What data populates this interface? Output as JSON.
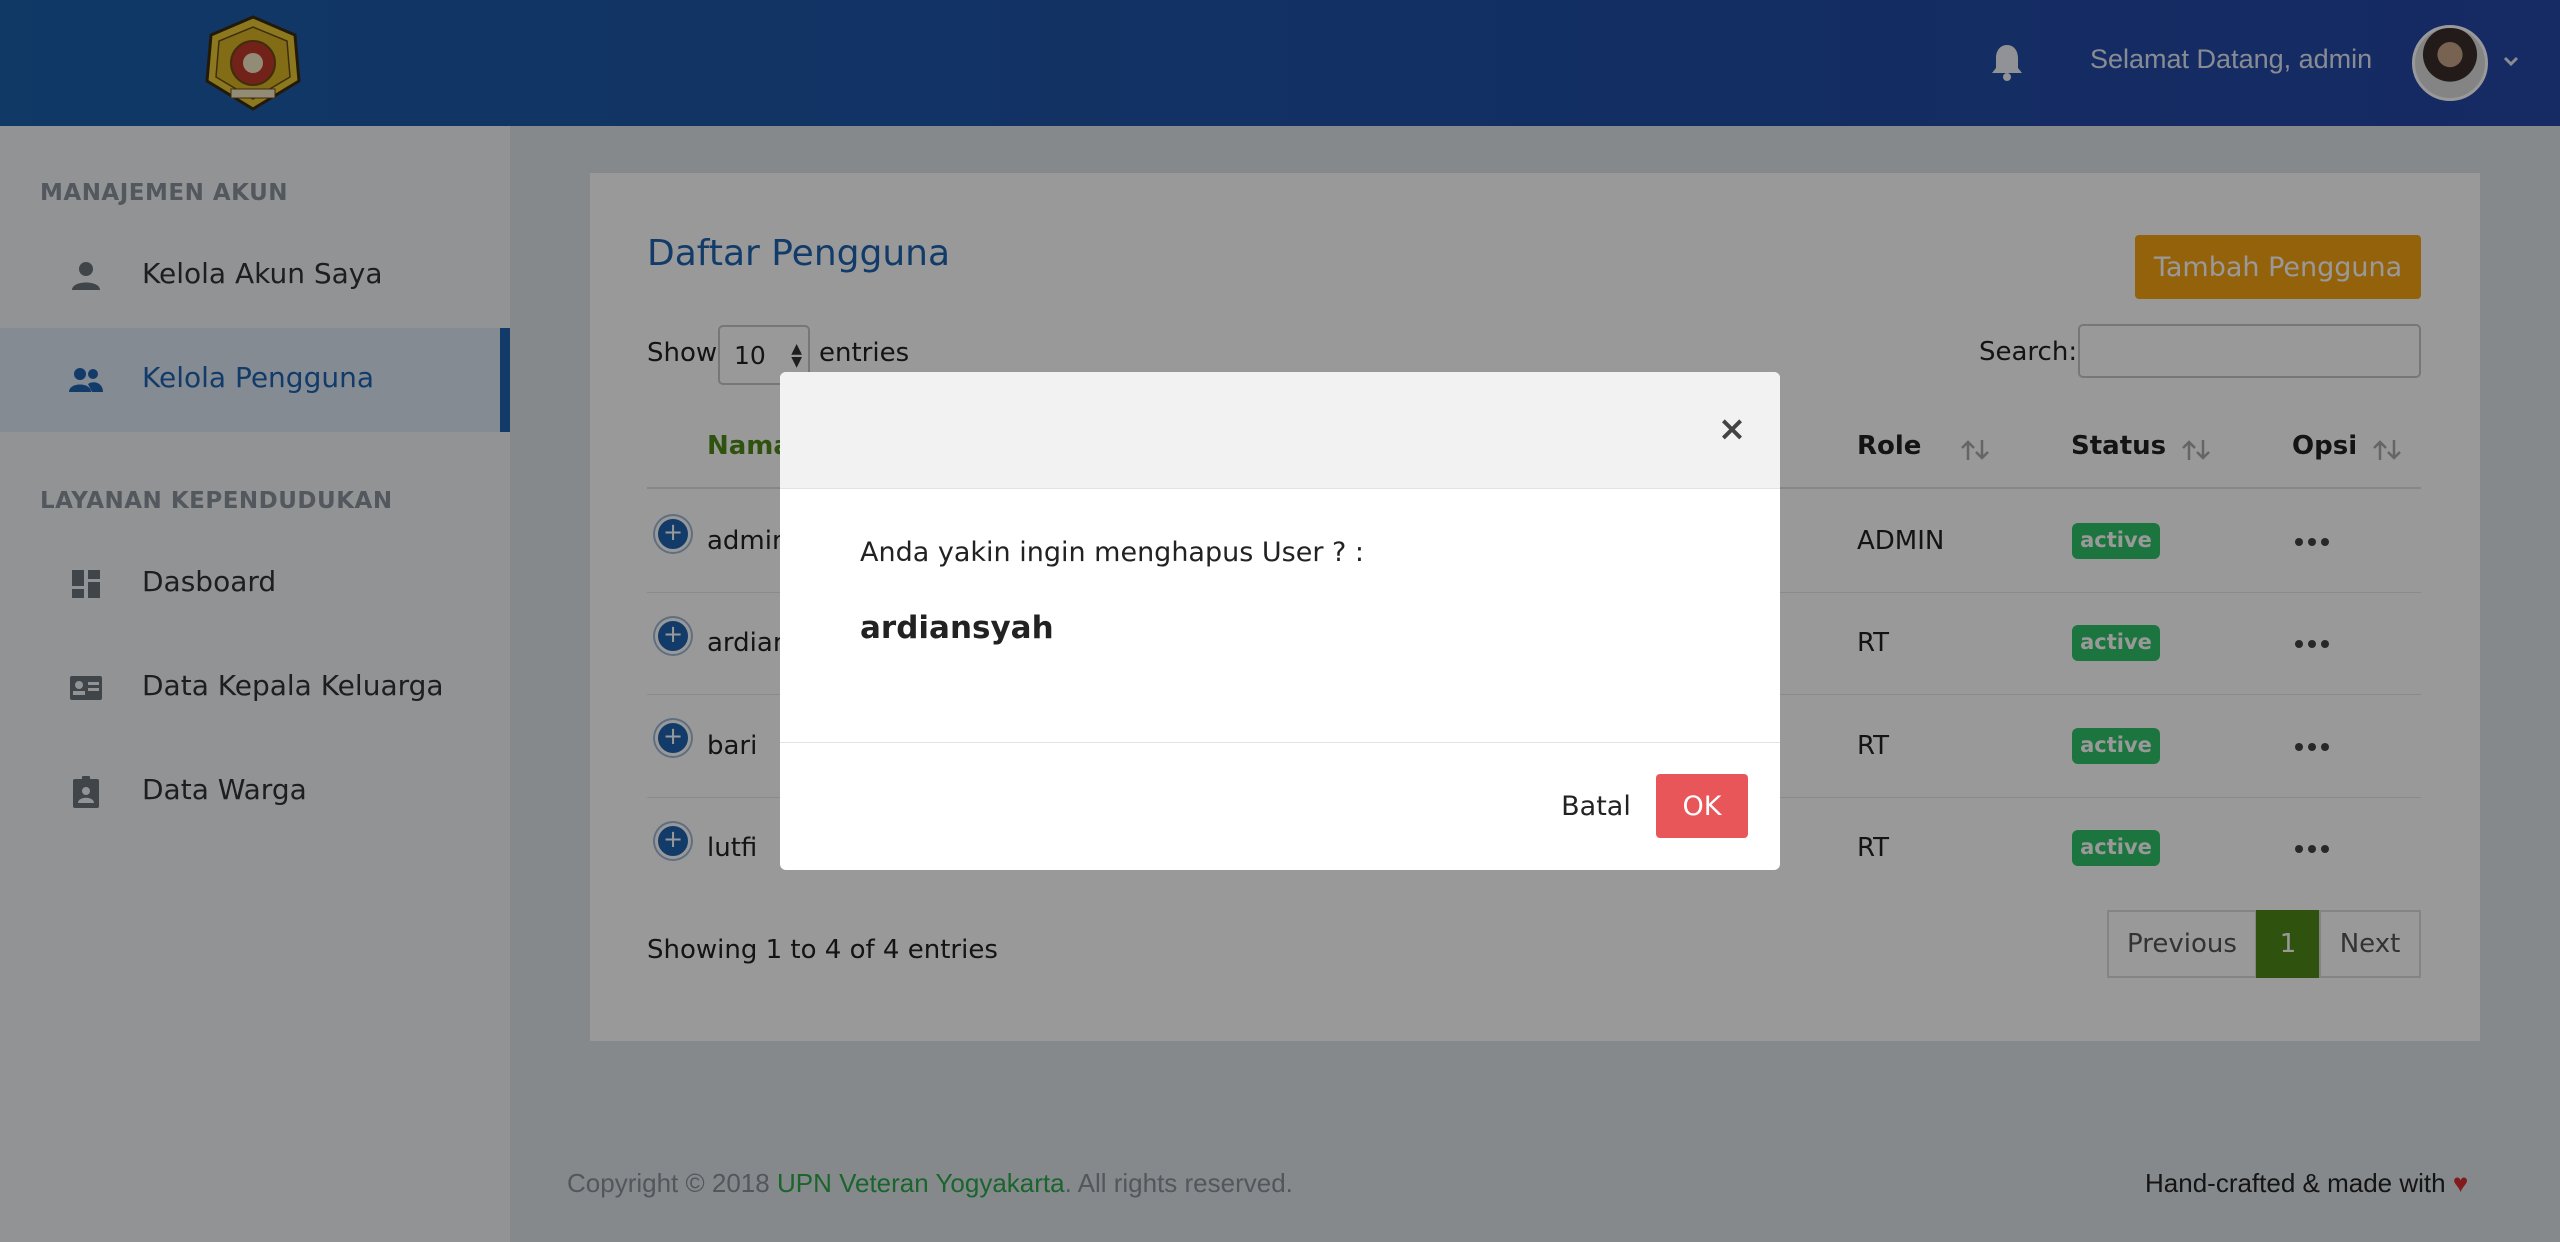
{
  "header": {
    "welcome": "Selamat Datang, admin",
    "icons": {
      "bell": "bell-icon",
      "caret": "chevron-down-icon",
      "logo": "university-seal-logo"
    },
    "colors": {
      "bar_start": "#1c5fab",
      "bar_end": "#2546a6"
    }
  },
  "sidebar": {
    "section_account": "MANAJEMEN AKUN",
    "section_services": "LAYANAN KEPENDUDUKAN",
    "items": [
      {
        "label": "Kelola Akun Saya",
        "icon": "person-icon",
        "active": false
      },
      {
        "label": "Kelola Pengguna",
        "icon": "people-icon",
        "active": true
      },
      {
        "label": "Dasboard",
        "icon": "dashboard-icon",
        "active": false
      },
      {
        "label": "Data Kepala Keluarga",
        "icon": "id-card-icon",
        "active": false
      },
      {
        "label": "Data Warga",
        "icon": "badge-icon",
        "active": false
      }
    ],
    "active_color": "#1e63b0"
  },
  "main": {
    "title": "Daftar Pengguna",
    "add_button": "Tambah Pengguna",
    "show_label": "Show",
    "entries_value": "10",
    "entries_label": "entries",
    "search_label": "Search:",
    "search_value": "",
    "columns": {
      "name": "Nama",
      "role": "Role",
      "status": "Status",
      "options": "Opsi"
    },
    "rows": [
      {
        "name": "admin",
        "role": "ADMIN",
        "status": "active"
      },
      {
        "name": "ardian",
        "role": "RT",
        "status": "active"
      },
      {
        "name": "bari",
        "role": "RT",
        "status": "active"
      },
      {
        "name": "lutfi",
        "role": "RT",
        "status": "active"
      }
    ],
    "info": "Showing 1 to 4 of 4 entries",
    "pagination": {
      "previous": "Previous",
      "current": "1",
      "next": "Next"
    },
    "colors": {
      "add_button": "#f7a313",
      "badge": "#2fc168",
      "page_current": "#4f8a18"
    }
  },
  "footer": {
    "copyright_prefix": "Copyright © 2018 ",
    "brand": "UPN Veteran Yogyakarta",
    "copyright_suffix": ". All rights reserved.",
    "right": "Hand-crafted & made with ",
    "heart": "♥"
  },
  "modal": {
    "close": "×",
    "message": "Anda yakin ingin menghapus User ? :",
    "username": "ardiansyah",
    "cancel": "Batal",
    "ok": "OK",
    "colors": {
      "ok": "#e8565a"
    }
  }
}
